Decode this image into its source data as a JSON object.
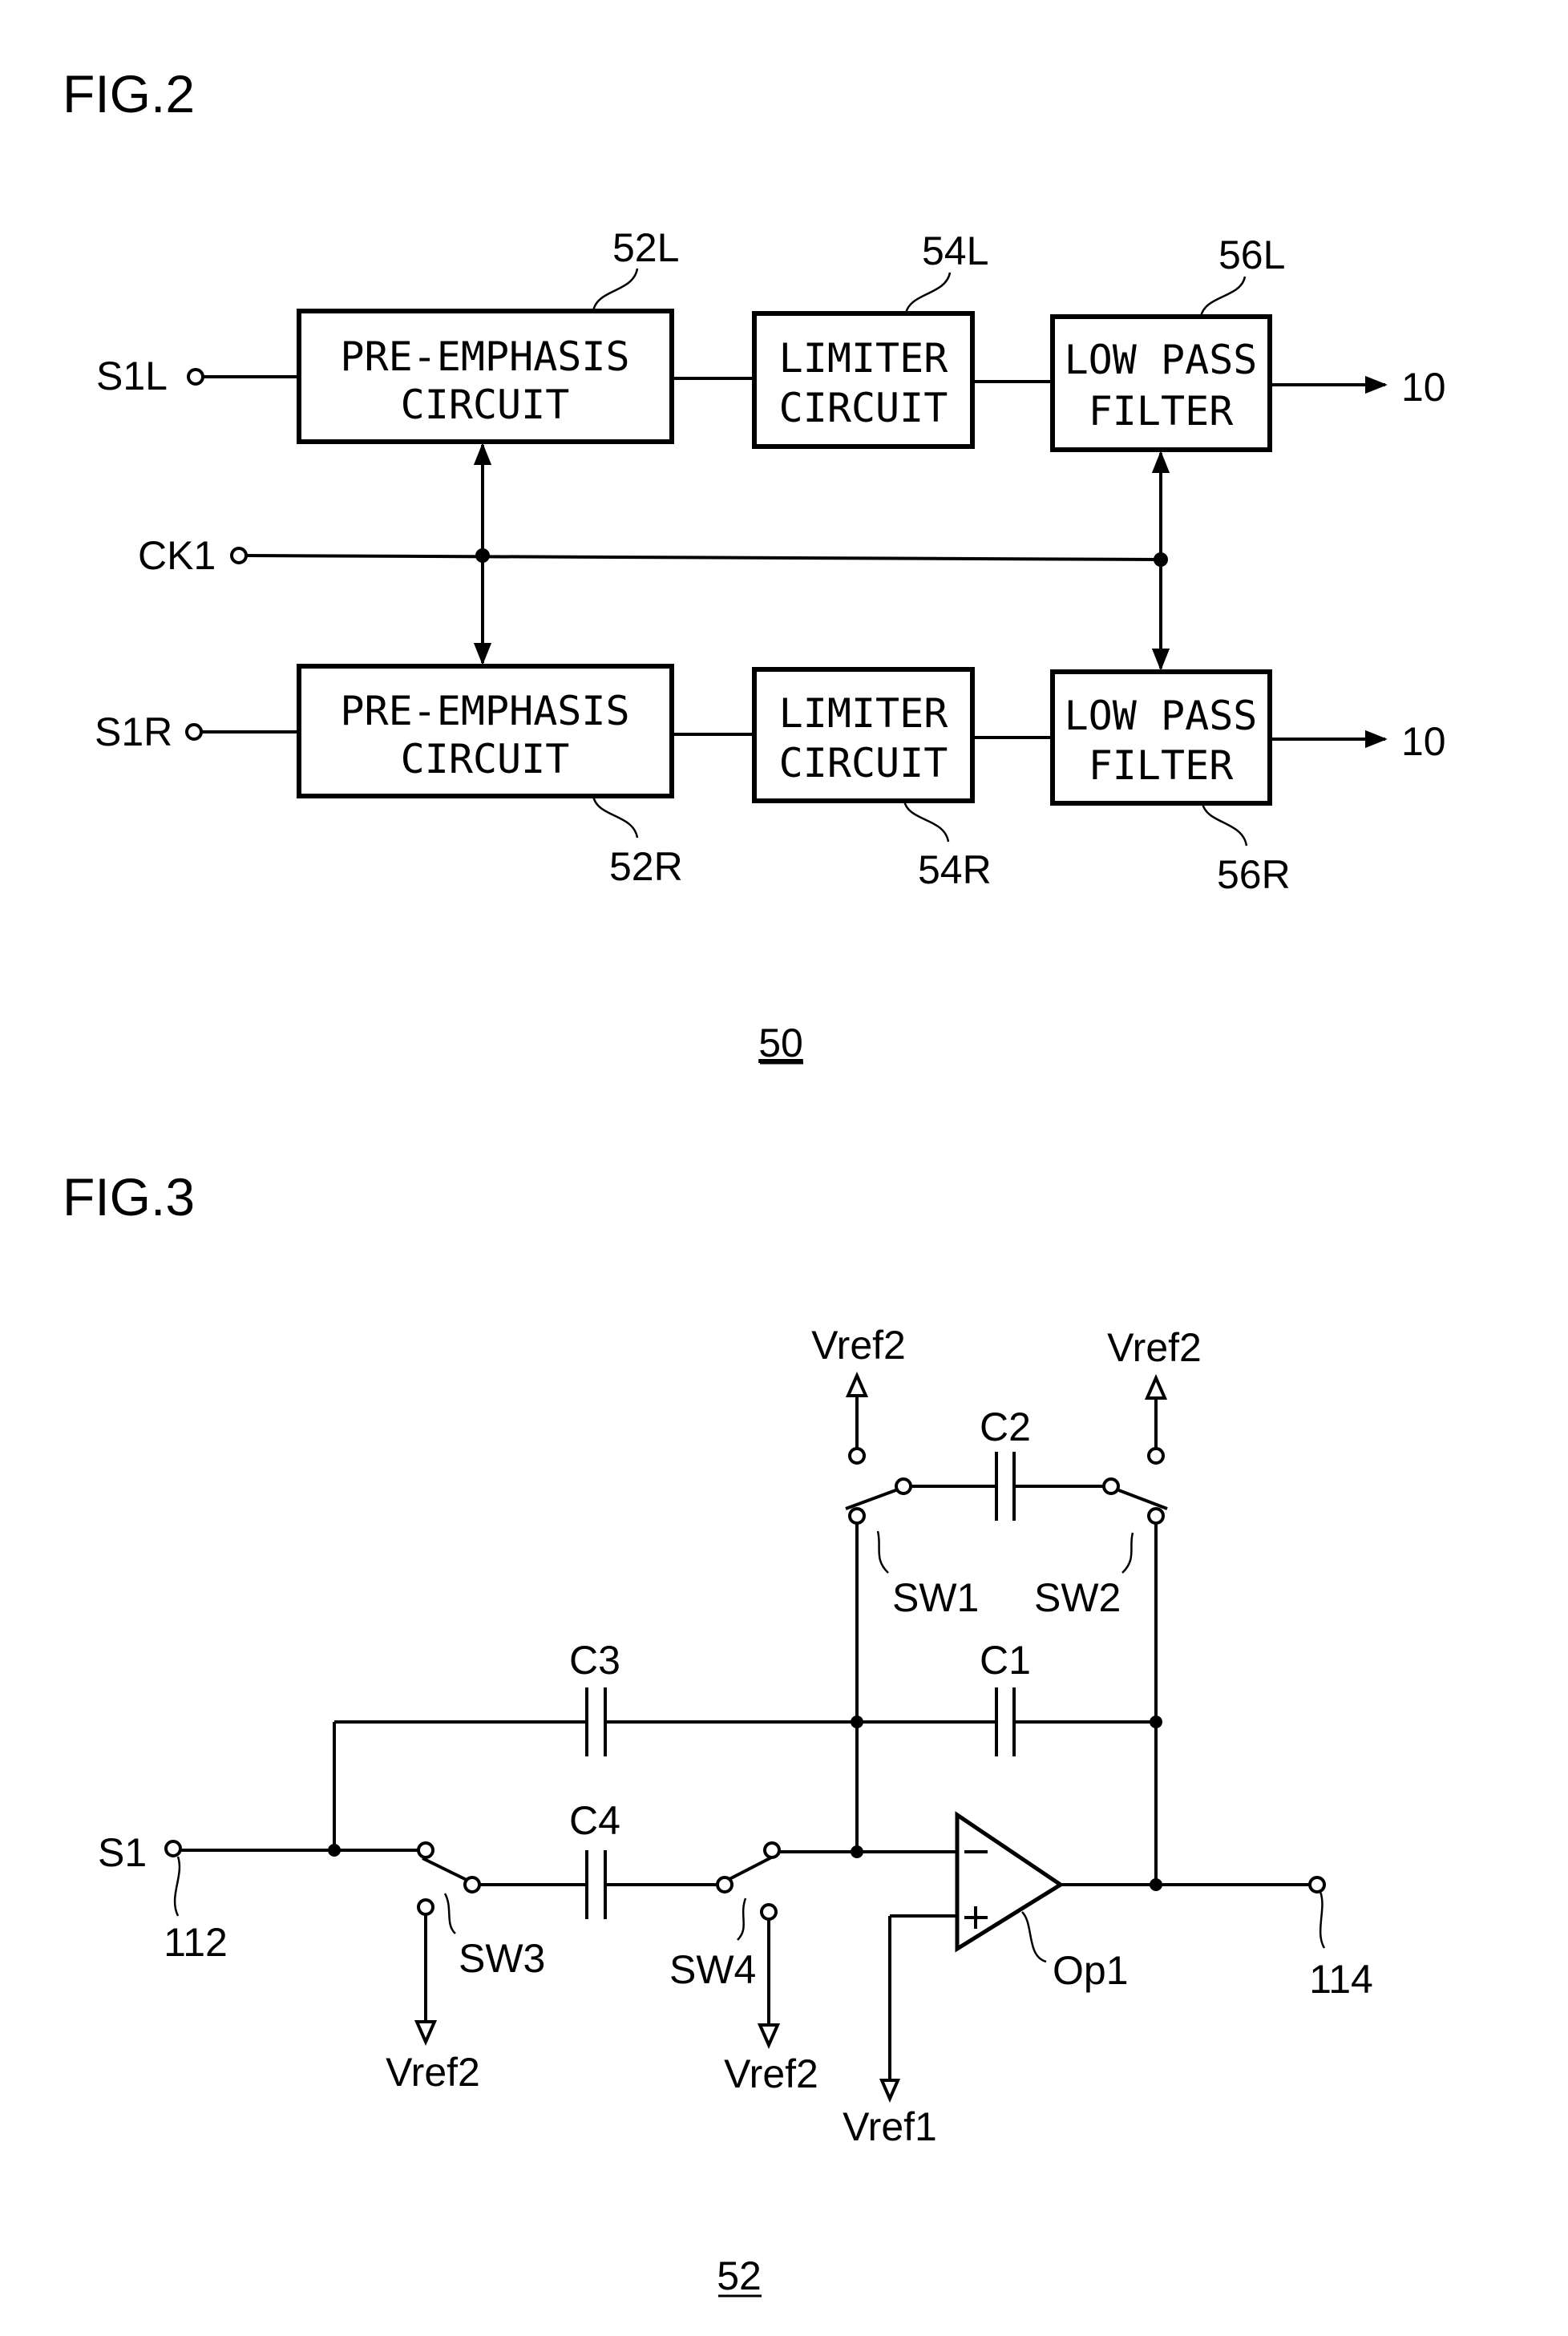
{
  "figure2": {
    "title": "FIG.2",
    "ref_number": "50",
    "inputs": {
      "left": "S1L",
      "clock": "CK1",
      "right": "S1R"
    },
    "output_label": "10",
    "blocks": [
      {
        "id": "52L",
        "line1": "PRE-EMPHASIS",
        "line2": "CIRCUIT"
      },
      {
        "id": "54L",
        "line1": "LIMITER",
        "line2": "CIRCUIT"
      },
      {
        "id": "56L",
        "line1": "LOW PASS",
        "line2": "FILTER"
      },
      {
        "id": "52R",
        "line1": "PRE-EMPHASIS",
        "line2": "CIRCUIT"
      },
      {
        "id": "54R",
        "line1": "LIMITER",
        "line2": "CIRCUIT"
      },
      {
        "id": "56R",
        "line1": "LOW PASS",
        "line2": "FILTER"
      }
    ]
  },
  "figure3": {
    "title": "FIG.3",
    "ref_number": "52",
    "input": {
      "name": "S1",
      "ref": "112"
    },
    "output": {
      "ref": "114"
    },
    "opamp": "Op1",
    "capacitors": [
      "C1",
      "C2",
      "C3",
      "C4"
    ],
    "switches": [
      "SW1",
      "SW2",
      "SW3",
      "SW4"
    ],
    "references": {
      "vref1": "Vref1",
      "vref2": "Vref2"
    }
  }
}
